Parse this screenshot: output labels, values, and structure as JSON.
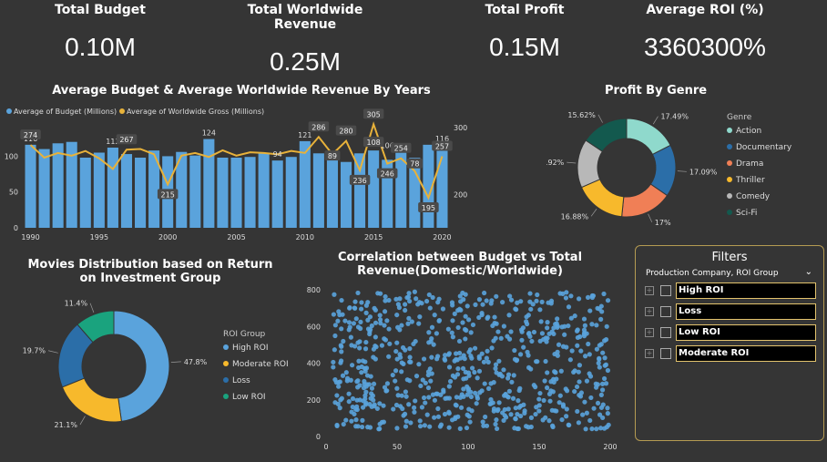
{
  "kpis": [
    {
      "label": "Total Budget",
      "value": "0.10M"
    },
    {
      "label": "Total Worldwide Revenue",
      "value": "0.25M"
    },
    {
      "label": "Total Profit",
      "value": "0.15M"
    },
    {
      "label": "Average ROI (%)",
      "value": "3360300%"
    }
  ],
  "titles": {
    "budget_revenue": "Average Budget & Average Worldwide Revenue By Years",
    "profit_genre": "Profit By Genre",
    "roi_distribution": "Movies Distribution based on Return on Investment Group",
    "correlation": "Correlation between Budget vs Total Revenue(Domestic/Worldwide)"
  },
  "filters": {
    "title": "Filters",
    "header": "Production Company, ROI Group",
    "items": [
      "High ROI",
      "Loss",
      "Low ROI",
      "Moderate ROI"
    ]
  },
  "chart_data": [
    {
      "type": "bar",
      "title": "Average Budget & Average Worldwide Revenue By Years",
      "legend": [
        "Average of Budget (Millions)",
        "Average of Worldwide Gross (Millions)"
      ],
      "legend_position": "top-left",
      "x": [
        1990,
        1991,
        1992,
        1993,
        1994,
        1995,
        1996,
        1997,
        1998,
        1999,
        2000,
        2001,
        2002,
        2003,
        2004,
        2005,
        2006,
        2007,
        2008,
        2009,
        2010,
        2011,
        2012,
        2013,
        2014,
        2015,
        2016,
        2017,
        2018,
        2019,
        2020
      ],
      "x_ticks": [
        1990,
        1995,
        2000,
        2005,
        2010,
        2015,
        2020
      ],
      "y_left_ticks": [
        0,
        50,
        100
      ],
      "y_right_ticks": [
        200,
        300
      ],
      "series": [
        {
          "name": "Average of Budget (Millions)",
          "color": "#5aa3dc",
          "values": [
            116,
            110,
            118,
            120,
            98,
            105,
            112,
            103,
            98,
            108,
            100,
            106,
            101,
            124,
            98,
            98,
            99,
            104,
            94,
            99,
            121,
            104,
            97,
            92,
            104,
            108,
            95,
            106,
            98,
            116,
            116
          ]
        },
        {
          "name": "Average of Worldwide Gross (Millions)",
          "color": "#e8b23a",
          "values": [
            274,
            255,
            262,
            258,
            265,
            254,
            238,
            267,
            268,
            260,
            215,
            258,
            262,
            256,
            266,
            258,
            263,
            262,
            260,
            265,
            262,
            286,
            260,
            280,
            236,
            305,
            246,
            254,
            235,
            195,
            257
          ]
        }
      ],
      "data_labels": {
        "budget": [
          {
            "x": 1990,
            "v": 116
          },
          {
            "x": 1996,
            "v": 112
          },
          {
            "x": 2003,
            "v": 124
          },
          {
            "x": 2008,
            "v": 94
          },
          {
            "x": 2010,
            "v": 121
          },
          {
            "x": 2016,
            "v": 106
          },
          {
            "x": 2020,
            "v": 116
          }
        ],
        "gross": [
          {
            "x": 1990,
            "v": 274
          },
          {
            "x": 1997,
            "v": 267
          },
          {
            "x": 2000,
            "v": 215
          },
          {
            "x": 2011,
            "v": 286
          },
          {
            "x": 2012,
            "v": 89
          },
          {
            "x": 2013,
            "v": 280
          },
          {
            "x": 2014,
            "v": 236
          },
          {
            "x": 2015,
            "v": 108
          },
          {
            "x": 2015,
            "v": 305
          },
          {
            "x": 2016,
            "v": 246
          },
          {
            "x": 2017,
            "v": 254
          },
          {
            "x": 2018,
            "v": 78
          },
          {
            "x": 2019,
            "v": 195
          },
          {
            "x": 2020,
            "v": 257
          }
        ]
      }
    },
    {
      "type": "pie",
      "title": "Profit By Genre",
      "legend_title": "Genre",
      "legend_position": "right",
      "labels": [
        "Action",
        "Documentary",
        "Drama",
        "Thriller",
        "Comedy",
        "Sci-Fi"
      ],
      "values": [
        17.49,
        17.09,
        17,
        16.88,
        15.92,
        15.62
      ],
      "value_labels": [
        "17.49%",
        "17.09%",
        "17%",
        "16.88%",
        "15.92%",
        "15.62%"
      ],
      "colors": [
        "#8fd9cc",
        "#2b6ea8",
        "#f07f56",
        "#f7b92c",
        "#b8b8b8",
        "#13594e"
      ]
    },
    {
      "type": "pie",
      "title": "Movies Distribution based on Return on Investment Group",
      "legend_title": "ROI Group",
      "legend_position": "right",
      "labels": [
        "High ROI",
        "Moderate ROI",
        "Loss",
        "Low ROI"
      ],
      "values": [
        47.8,
        21.1,
        19.7,
        11.4
      ],
      "value_labels": [
        "47.8%",
        "21.1%",
        "19.7%",
        "11.4%"
      ],
      "colors": [
        "#5aa3dc",
        "#f7b92c",
        "#2b6ea8",
        "#1aa37e"
      ]
    },
    {
      "type": "scatter",
      "title": "Correlation between Budget vs Total Revenue(Domestic/Worldwide)",
      "x_ticks": [
        0,
        50,
        100,
        150,
        200
      ],
      "y_ticks": [
        0,
        200,
        400,
        600,
        800
      ],
      "xlim": [
        0,
        200
      ],
      "ylim": [
        0,
        800
      ],
      "color": "#5aa3dc",
      "point_count": 700,
      "note_distribution": "uniform"
    }
  ]
}
